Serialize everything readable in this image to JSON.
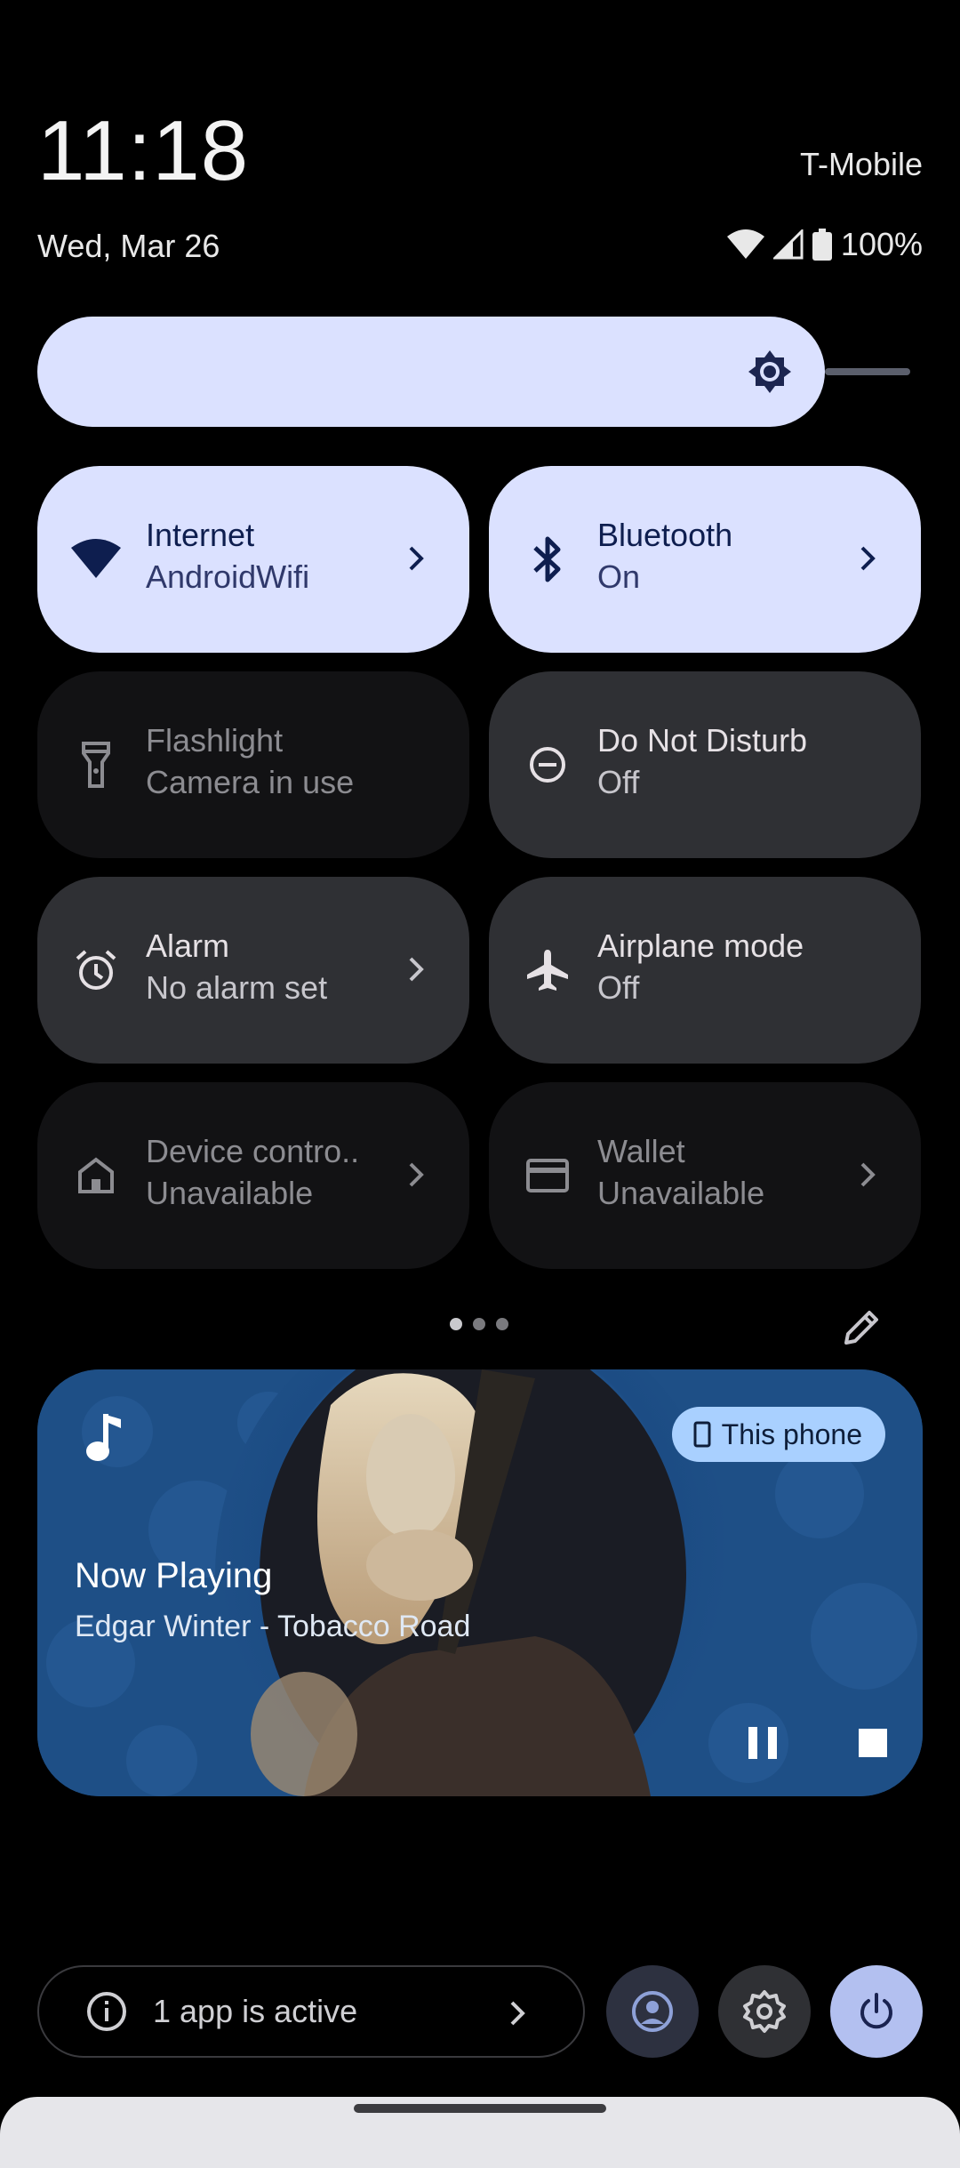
{
  "header": {
    "time": "11:18",
    "date": "Wed, Mar 26",
    "carrier": "T-Mobile",
    "battery": "100%",
    "icons": [
      "wifi-icon",
      "cell-signal-icon",
      "battery-icon"
    ]
  },
  "brightness": {
    "icon": "brightness-icon",
    "level": 0.88
  },
  "tiles": [
    {
      "name": "Internet",
      "sub": "AndroidWifi",
      "state": "on",
      "icon": "wifi-icon",
      "chevron": true
    },
    {
      "name": "Bluetooth",
      "sub": "On",
      "state": "on",
      "icon": "bluetooth-icon",
      "chevron": true
    },
    {
      "name": "Flashlight",
      "sub": "Camera in use",
      "state": "unavailable",
      "icon": "flashlight-icon",
      "chevron": false
    },
    {
      "name": "Do Not Disturb",
      "sub": "Off",
      "state": "off",
      "icon": "do-not-disturb-icon",
      "chevron": false
    },
    {
      "name": "Alarm",
      "sub": "No alarm set",
      "state": "off",
      "icon": "alarm-icon",
      "chevron": true
    },
    {
      "name": "Airplane mode",
      "sub": "Off",
      "state": "off",
      "icon": "airplane-icon",
      "chevron": false
    },
    {
      "name": "Device contro..",
      "sub": "Unavailable",
      "state": "unavailable",
      "icon": "home-icon",
      "chevron": true
    },
    {
      "name": "Wallet",
      "sub": "Unavailable",
      "state": "unavailable",
      "icon": "wallet-icon",
      "chevron": true
    }
  ],
  "pager": {
    "pages": 3,
    "current": 1
  },
  "media": {
    "title": "Now Playing",
    "subtitle": "Edgar Winter - Tobacco Road",
    "output_device": "This phone",
    "colors": {
      "background": "#1e4f86",
      "chip": "#a9d0ff"
    }
  },
  "footer": {
    "active_apps": "1 app is active"
  },
  "colors": {
    "tile_on": "#dbe1ff",
    "tile_off": "#2f3034",
    "tile_unavailable": "#121214",
    "power_button": "#b3c0f0"
  }
}
